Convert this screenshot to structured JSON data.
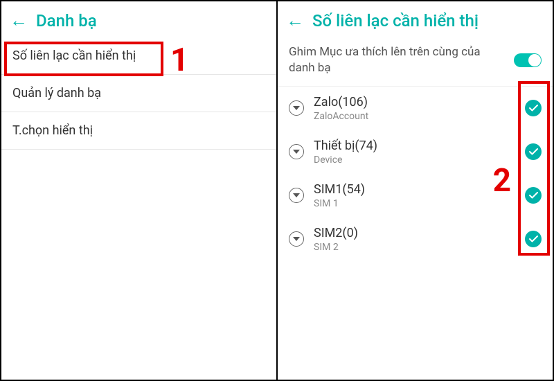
{
  "colors": {
    "accent": "#00b2a9",
    "highlight": "#e30000"
  },
  "annotations": {
    "step1": "1",
    "step2": "2"
  },
  "left": {
    "title": "Danh bạ",
    "items": [
      {
        "label": "Số liên lạc cần hiển thị"
      },
      {
        "label": "Quản lý danh bạ"
      },
      {
        "label": "T.chọn hiển thị"
      }
    ]
  },
  "right": {
    "title": "Số liên lạc cần hiển thị",
    "pin_label": "Ghim Mục ưa thích lên trên cùng của danh bạ",
    "pin_on": true,
    "accounts": [
      {
        "title": "Zalo(106)",
        "sub": "ZaloAccount",
        "checked": true
      },
      {
        "title": "Thiết bị(74)",
        "sub": "Device",
        "checked": true
      },
      {
        "title": "SIM1(54)",
        "sub": "SIM 1",
        "checked": true
      },
      {
        "title": "SIM2(0)",
        "sub": "SIM 2",
        "checked": true
      }
    ]
  }
}
